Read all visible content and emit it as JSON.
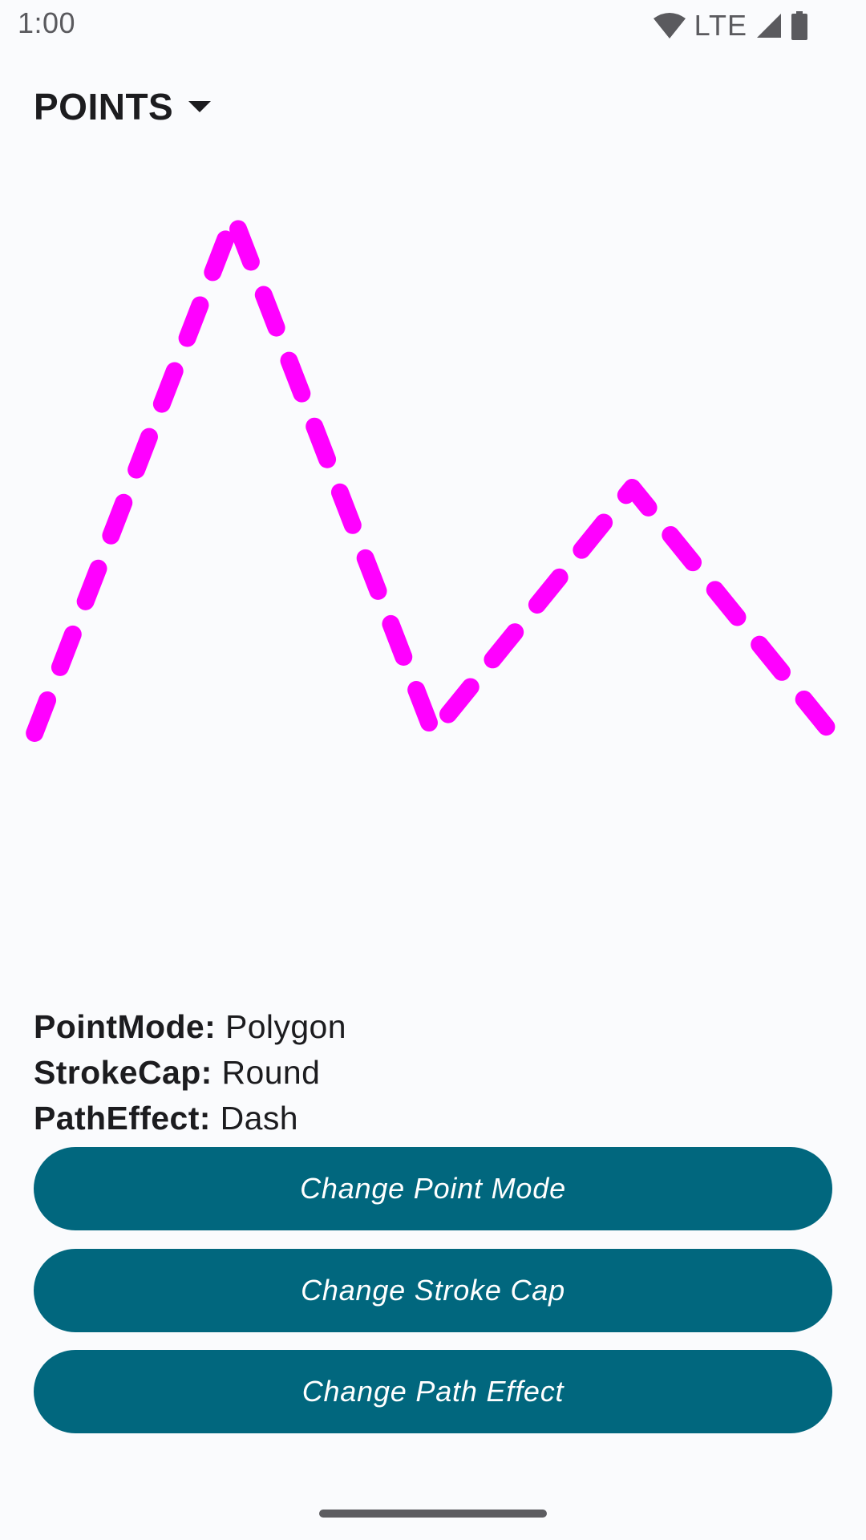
{
  "status_bar": {
    "time": "1:00",
    "network": "LTE",
    "icons": [
      "wifi-icon",
      "cell-signal-icon",
      "battery-icon"
    ]
  },
  "header": {
    "dropdown_label": "POINTS",
    "dropdown_icon": "caret-down-icon"
  },
  "drawing": {
    "point_mode": "Polygon",
    "stroke_cap": "Round",
    "path_effect": "Dash",
    "stroke_color": "#ff00ff",
    "points": [
      [
        0.04,
        0.7
      ],
      [
        0.27,
        0.07
      ],
      [
        0.5,
        0.7
      ],
      [
        0.73,
        0.4
      ],
      [
        0.96,
        0.7
      ]
    ]
  },
  "info": {
    "point_mode_key": "PointMode:",
    "point_mode_value": "Polygon",
    "stroke_cap_key": "StrokeCap:",
    "stroke_cap_value": "Round",
    "path_effect_key": "PathEffect:",
    "path_effect_value": "Dash"
  },
  "buttons": {
    "change_point_mode": "Change Point Mode",
    "change_stroke_cap": "Change Stroke Cap",
    "change_path_effect": "Change Path Effect"
  },
  "colors": {
    "button_bg": "#01677e",
    "background": "#fafbfd",
    "stroke": "#ff00ff"
  }
}
